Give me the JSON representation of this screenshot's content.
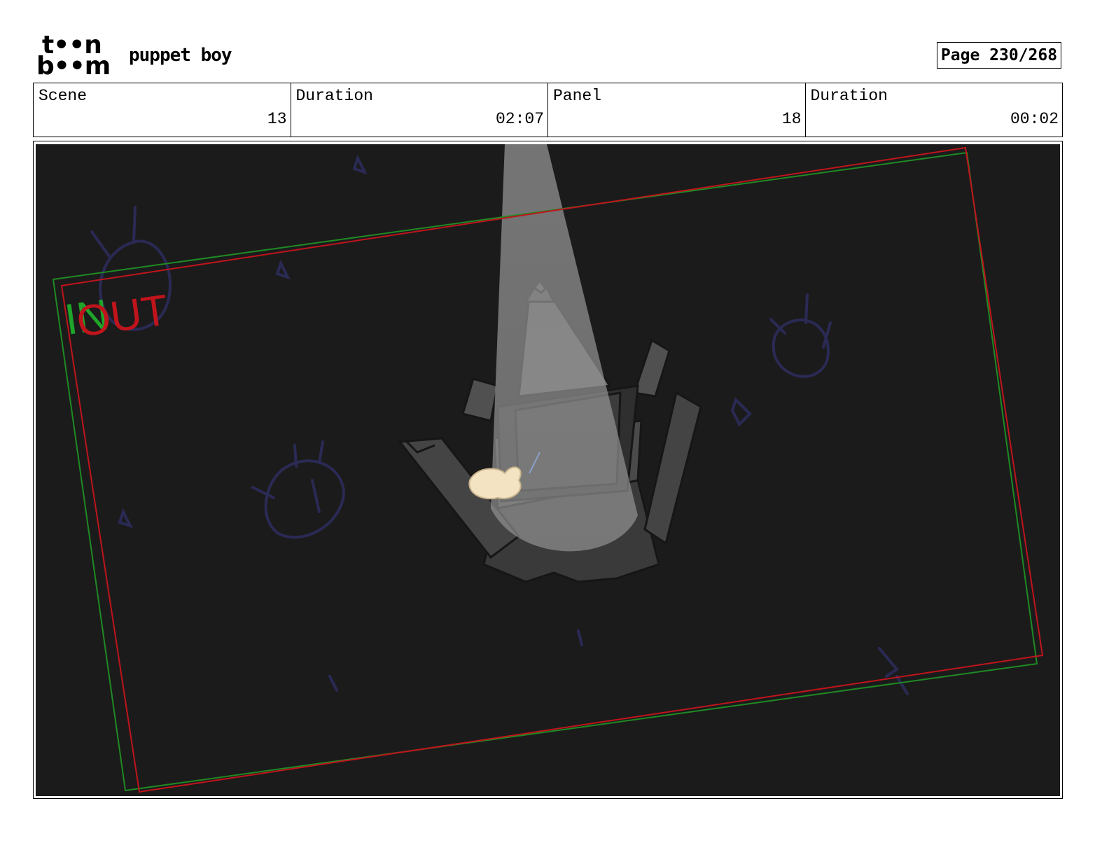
{
  "logo": {
    "line1": "t••n",
    "line2": "b••m"
  },
  "project_title": "puppet boy",
  "page_indicator": "Page 230/268",
  "info": [
    {
      "label": "Scene",
      "value": "13"
    },
    {
      "label": "Duration",
      "value": "02:07"
    },
    {
      "label": "Panel",
      "value": "18"
    },
    {
      "label": "Duration",
      "value": "00:02"
    }
  ],
  "overlay": {
    "in_label": "IN",
    "out_label": "OUT",
    "in_color": "#1fa62a",
    "out_color": "#c0141c"
  },
  "colors": {
    "background": "#1b1b1b",
    "sketch": "#2a2a55"
  }
}
